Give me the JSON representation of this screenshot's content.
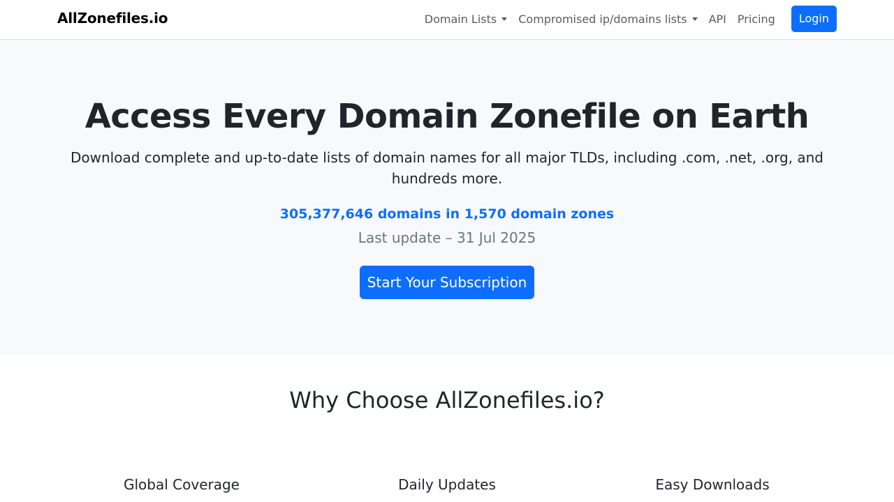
{
  "navbar": {
    "brand": "AllZonefiles.io",
    "items": [
      {
        "label": "Domain Lists",
        "dropdown": true
      },
      {
        "label": "Compromised ip/domains lists",
        "dropdown": true
      },
      {
        "label": "API",
        "dropdown": false
      },
      {
        "label": "Pricing",
        "dropdown": false
      }
    ],
    "login_label": "Login"
  },
  "hero": {
    "title": "Access Every Domain Zonefile on Earth",
    "subtitle": "Download complete and up-to-date lists of domain names for all major TLDs, including .com, .net, .org, and hundreds more.",
    "stats": "305,377,646 domains in 1,570 domain zones",
    "last_update": "Last update – 31 Jul 2025",
    "cta_label": "Start Your Subscription"
  },
  "why": {
    "title": "Why Choose AllZonefiles.io?",
    "features": [
      {
        "title": "Global Coverage"
      },
      {
        "title": "Daily Updates"
      },
      {
        "title": "Easy Downloads"
      }
    ]
  },
  "colors": {
    "primary": "#0d6efd",
    "hero_bg": "#f8f9fa",
    "muted": "#6c757d"
  }
}
